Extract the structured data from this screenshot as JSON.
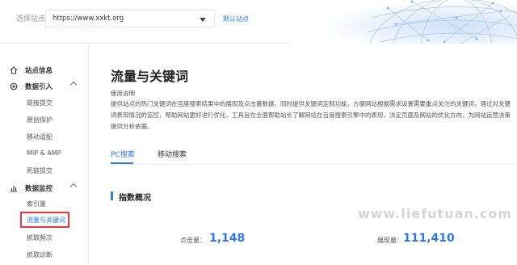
{
  "topbar": {
    "site_label": "选择站点：",
    "site_value": "https://www.xxkt.org",
    "default_site": "默认站点"
  },
  "sidebar": {
    "groups": [
      {
        "label": "站点信息",
        "icon": "home-icon"
      },
      {
        "label": "数据引入",
        "icon": "data-import-icon",
        "items": [
          "链接提交",
          "原创保护",
          "移动适配",
          "MIP & AMP",
          "死链提交"
        ]
      },
      {
        "label": "数据监控",
        "icon": "chart-icon",
        "items": [
          "索引量",
          "流量与关键词",
          "抓取频次",
          "抓取诊断"
        ]
      }
    ],
    "active_item": "流量与关键词"
  },
  "main": {
    "title": "流量与关键词",
    "usage_label": "使用说明",
    "usage_text": "提供站点的热门关键词在百度搜索结果中的展现及点击量数据，同时提供关键词定制功能，方便网站根据需求设置需要重点关注的关键词，通过对关键词表现情况的监控，帮助网站更好进行优化，工具旨在全面帮助站长了解网站在百度搜索引擎中的表现，决定页面及网站的优化方向，为网站运营决策提供分析依据。",
    "tabs": [
      "PC搜索",
      "移动搜索"
    ],
    "active_tab": "PC搜索",
    "section_title": "指数概况",
    "metrics": [
      {
        "label": "点击量：",
        "value": "1,148"
      },
      {
        "label": "展现量：",
        "value": "111,410"
      }
    ]
  },
  "watermark": "www.liefutuan.com",
  "colors": {
    "accent": "#2d77e6",
    "highlight_box": "#e53935"
  }
}
